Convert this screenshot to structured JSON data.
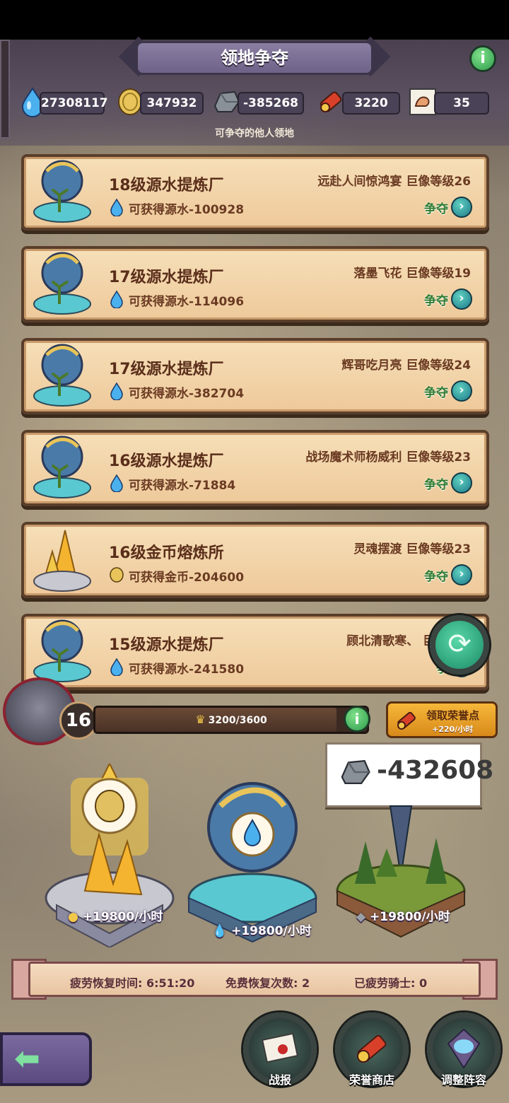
{
  "header": {
    "title": "领地争夺",
    "info_label": "i",
    "subtitle": "可争夺的他人领地"
  },
  "resources": [
    {
      "name": "源水",
      "icon": "water-drop-icon",
      "value": "27308117"
    },
    {
      "name": "金币",
      "icon": "gold-coin-icon",
      "value": "347932"
    },
    {
      "name": "矿石",
      "icon": "ore-stone-icon",
      "value": "-385268"
    },
    {
      "name": "荣誉卷轴",
      "icon": "honor-scroll-icon",
      "value": "3220"
    },
    {
      "name": "力量",
      "icon": "muscle-poster-icon",
      "value": "35"
    }
  ],
  "territories": [
    {
      "name": "18级源水提炼厂",
      "gain": "可获得源水-100928",
      "owner": "远赴人间惊鸿宴  巨像等级26",
      "type": "water",
      "action": "争夺"
    },
    {
      "name": "17级源水提炼厂",
      "gain": "可获得源水-114096",
      "owner": "落墨飞花  巨像等级19",
      "type": "water",
      "action": "争夺"
    },
    {
      "name": "17级源水提炼厂",
      "gain": "可获得源水-382704",
      "owner": "辉哥吃月亮  巨像等级24",
      "type": "water",
      "action": "争夺"
    },
    {
      "name": "16级源水提炼厂",
      "gain": "可获得源水-71884",
      "owner": "战场魔术师杨威利  巨像等级23",
      "type": "water",
      "action": "争夺"
    },
    {
      "name": "16级金币熔炼所",
      "gain": "可获得金币-204600",
      "owner": "灵魂摆渡  巨像等级23",
      "type": "gold",
      "action": "争夺"
    },
    {
      "name": "15级源水提炼厂",
      "gain": "可获得源水-241580",
      "owner": "顾北清歌寒、 巨像等级",
      "type": "water",
      "action": "争"
    }
  ],
  "player": {
    "level": "16",
    "progress_text": "3200/3600",
    "progress_fraction": 0.889,
    "info_label": "i"
  },
  "honor_button": {
    "label": "领取荣誉点",
    "rate": "+220/小时"
  },
  "stone_popup": {
    "value": "-432608"
  },
  "productions": [
    {
      "icon": "gold-coin-icon",
      "label": "+19800/小时"
    },
    {
      "icon": "water-drop-icon",
      "label": "+19800/小时"
    },
    {
      "icon": "ore-stone-icon",
      "label": "+19800/小时"
    }
  ],
  "status": {
    "recover_time": "疲劳恢复时间: 6:51:20",
    "free_recover": "免费恢复次数: 2",
    "tired_knights": "已疲劳骑士: 0"
  },
  "bottom_nav": [
    {
      "label": "战报",
      "icon": "letter-icon"
    },
    {
      "label": "荣誉商店",
      "icon": "honor-scroll-icon"
    },
    {
      "label": "调整阵容",
      "icon": "formation-gem-icon"
    }
  ],
  "colors": {
    "accent_purple": "#6e6288",
    "card_bg": "#f6dfb8",
    "grab_green": "#2e7a2e",
    "info_green": "#2e9c4c"
  }
}
